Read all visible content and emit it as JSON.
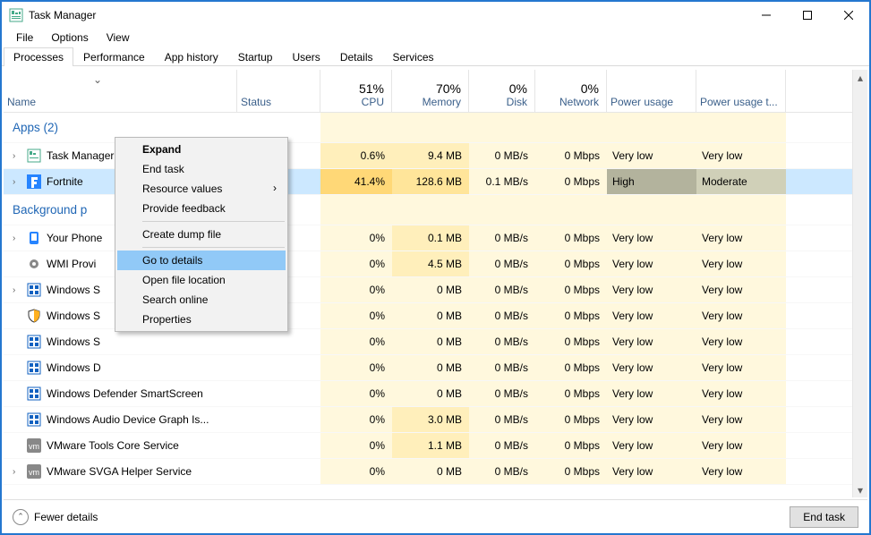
{
  "window": {
    "title": "Task Manager"
  },
  "menubar": [
    "File",
    "Options",
    "View"
  ],
  "tabs": [
    "Processes",
    "Performance",
    "App history",
    "Startup",
    "Users",
    "Details",
    "Services"
  ],
  "active_tab": 0,
  "columns": {
    "name": "Name",
    "status": "Status",
    "cpu": {
      "pct": "51%",
      "label": "CPU"
    },
    "mem": {
      "pct": "70%",
      "label": "Memory"
    },
    "disk": {
      "pct": "0%",
      "label": "Disk"
    },
    "net": {
      "pct": "0%",
      "label": "Network"
    },
    "power": "Power usage",
    "powertrend": "Power usage t..."
  },
  "groups": {
    "apps": "Apps (2)",
    "bg": "Background p"
  },
  "rows": [
    {
      "expand": true,
      "icon": "taskmgr",
      "name": "Task Manager",
      "status": "",
      "leaf": false,
      "cpu": "0.6%",
      "mem": "9.4 MB",
      "disk": "0 MB/s",
      "net": "0 Mbps",
      "power": "Very low",
      "trend": "Very low",
      "heat": [
        "h1",
        "h1",
        "h0",
        "h0"
      ],
      "selected": false
    },
    {
      "expand": true,
      "icon": "fortnite",
      "name": "Fortnite",
      "status": "",
      "leaf": false,
      "cpu": "41.4%",
      "mem": "128.6 MB",
      "disk": "0.1 MB/s",
      "net": "0 Mbps",
      "power": "High",
      "trend": "Moderate",
      "heat": [
        "h3",
        "h2",
        "h0",
        "h0"
      ],
      "pwr_heat": [
        "hg",
        "ht"
      ],
      "selected": true
    },
    {
      "expand": true,
      "icon": "phone",
      "name": "Your Phone",
      "status": "",
      "leaf": true,
      "cpu": "0%",
      "mem": "0.1 MB",
      "disk": "0 MB/s",
      "net": "0 Mbps",
      "power": "Very low",
      "trend": "Very low",
      "heat": [
        "h0",
        "h1",
        "h0",
        "h0"
      ],
      "selected": false
    },
    {
      "expand": false,
      "icon": "gear",
      "name": "WMI Provi",
      "status": "",
      "leaf": false,
      "cpu": "0%",
      "mem": "4.5 MB",
      "disk": "0 MB/s",
      "net": "0 Mbps",
      "power": "Very low",
      "trend": "Very low",
      "heat": [
        "h0",
        "h1",
        "h0",
        "h0"
      ],
      "selected": false
    },
    {
      "expand": true,
      "icon": "win",
      "name": "Windows S",
      "status": "",
      "leaf": true,
      "cpu": "0%",
      "mem": "0 MB",
      "disk": "0 MB/s",
      "net": "0 Mbps",
      "power": "Very low",
      "trend": "Very low",
      "heat": [
        "h0",
        "h0",
        "h0",
        "h0"
      ],
      "selected": false
    },
    {
      "expand": false,
      "icon": "shield",
      "name": "Windows S",
      "status": "",
      "leaf": false,
      "cpu": "0%",
      "mem": "0 MB",
      "disk": "0 MB/s",
      "net": "0 Mbps",
      "power": "Very low",
      "trend": "Very low",
      "heat": [
        "h0",
        "h0",
        "h0",
        "h0"
      ],
      "selected": false
    },
    {
      "expand": false,
      "icon": "win",
      "name": "Windows S",
      "status": "",
      "leaf": false,
      "cpu": "0%",
      "mem": "0 MB",
      "disk": "0 MB/s",
      "net": "0 Mbps",
      "power": "Very low",
      "trend": "Very low",
      "heat": [
        "h0",
        "h0",
        "h0",
        "h0"
      ],
      "selected": false
    },
    {
      "expand": false,
      "icon": "win",
      "name": "Windows D",
      "status": "",
      "leaf": false,
      "cpu": "0%",
      "mem": "0 MB",
      "disk": "0 MB/s",
      "net": "0 Mbps",
      "power": "Very low",
      "trend": "Very low",
      "heat": [
        "h0",
        "h0",
        "h0",
        "h0"
      ],
      "selected": false
    },
    {
      "expand": false,
      "icon": "win",
      "name": "Windows Defender SmartScreen",
      "status": "",
      "leaf": false,
      "cpu": "0%",
      "mem": "0 MB",
      "disk": "0 MB/s",
      "net": "0 Mbps",
      "power": "Very low",
      "trend": "Very low",
      "heat": [
        "h0",
        "h0",
        "h0",
        "h0"
      ],
      "selected": false
    },
    {
      "expand": false,
      "icon": "win",
      "name": "Windows Audio Device Graph Is...",
      "status": "",
      "leaf": false,
      "cpu": "0%",
      "mem": "3.0 MB",
      "disk": "0 MB/s",
      "net": "0 Mbps",
      "power": "Very low",
      "trend": "Very low",
      "heat": [
        "h0",
        "h1",
        "h0",
        "h0"
      ],
      "selected": false
    },
    {
      "expand": false,
      "icon": "vm",
      "name": "VMware Tools Core Service",
      "status": "",
      "leaf": false,
      "cpu": "0%",
      "mem": "1.1 MB",
      "disk": "0 MB/s",
      "net": "0 Mbps",
      "power": "Very low",
      "trend": "Very low",
      "heat": [
        "h0",
        "h1",
        "h0",
        "h0"
      ],
      "selected": false
    },
    {
      "expand": true,
      "icon": "vm",
      "name": "VMware SVGA Helper Service",
      "status": "",
      "leaf": false,
      "cpu": "0%",
      "mem": "0 MB",
      "disk": "0 MB/s",
      "net": "0 Mbps",
      "power": "Very low",
      "trend": "Very low",
      "heat": [
        "h0",
        "h0",
        "h0",
        "h0"
      ],
      "selected": false
    }
  ],
  "context_menu": {
    "items": [
      {
        "label": "Expand",
        "bold": true
      },
      {
        "label": "End task"
      },
      {
        "label": "Resource values",
        "submenu": true
      },
      {
        "label": "Provide feedback"
      },
      {
        "sep": true
      },
      {
        "label": "Create dump file"
      },
      {
        "sep": true
      },
      {
        "label": "Go to details",
        "hover": true
      },
      {
        "label": "Open file location"
      },
      {
        "label": "Search online"
      },
      {
        "label": "Properties"
      }
    ]
  },
  "bottombar": {
    "fewer": "Fewer details",
    "endtask": "End task"
  },
  "col_widths": {
    "name": 261,
    "status": 93,
    "cpu": 80,
    "mem": 86,
    "disk": 74,
    "net": 80,
    "power": 100,
    "trend": 100
  }
}
